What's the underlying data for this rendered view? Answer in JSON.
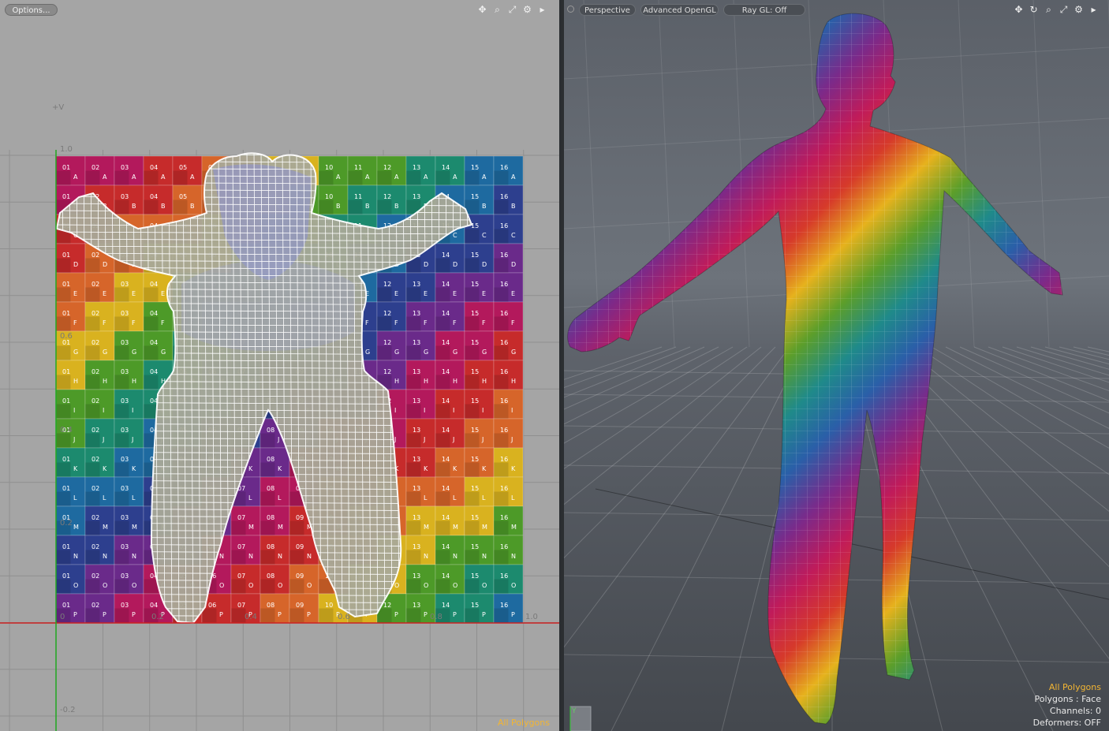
{
  "uv_viewport": {
    "options_label": "Options...",
    "axis_labels": {
      "v_axis": "+V",
      "top": "1.0",
      "left_06": "0.6",
      "left_04": "0.4",
      "left_02": "0.2",
      "bottom_0": "0",
      "bottom_02": "0.2",
      "bottom_04": "0.4",
      "bottom_06": "0.6",
      "bottom_08": "0.8",
      "right_10": "1.0",
      "below": "-0.2"
    },
    "tools": [
      "move-icon",
      "zoom-icon",
      "fit-icon",
      "gear-icon",
      "expand-arrow-icon"
    ],
    "status_selection": "All Polygons",
    "checker_rows": [
      "A",
      "B",
      "C",
      "D",
      "E",
      "F",
      "G",
      "H",
      "I",
      "J",
      "K",
      "L",
      "M",
      "N",
      "O",
      "P"
    ],
    "checker_cols": [
      "01",
      "02",
      "03",
      "04",
      "05",
      "06",
      "07",
      "08",
      "09",
      "10",
      "11",
      "12",
      "13",
      "14",
      "15",
      "16"
    ]
  },
  "perspective_viewport": {
    "view_mode": "Perspective",
    "shading": "Advanced OpenGL",
    "ray_gl": "Ray GL: Off",
    "tools": [
      "move-icon",
      "rotate-icon",
      "zoom-icon",
      "fit-icon",
      "gear-icon",
      "expand-arrow-icon"
    ],
    "info": {
      "selection": "All Polygons",
      "polygons": "Polygons : Face",
      "channels": "Channels: 0",
      "deformers": "Deformers: OFF"
    }
  },
  "colors": {
    "selection_text": "#f2b533",
    "uv_background": "#a5a5a5",
    "perspective_background": "#5e636b",
    "u_axis": "#c22",
    "v_axis": "#2a2"
  }
}
